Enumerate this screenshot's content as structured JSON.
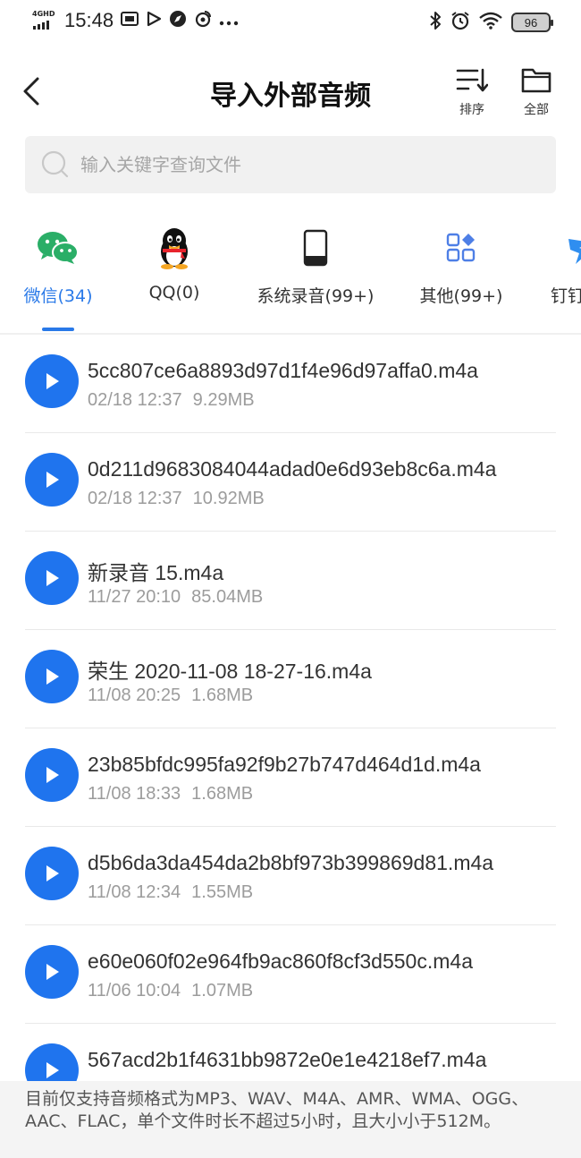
{
  "status_bar": {
    "network": "4GHD",
    "time": "15:48",
    "battery": "96"
  },
  "header": {
    "title": "导入外部音频",
    "sort_label": "排序",
    "all_label": "全部"
  },
  "search": {
    "placeholder": "输入关键字查询文件"
  },
  "tabs": [
    {
      "label": "微信(34)",
      "icon": "wechat-icon",
      "active": true
    },
    {
      "label": "QQ(0)",
      "icon": "qq-icon",
      "active": false
    },
    {
      "label": "系统录音(99+)",
      "icon": "phone-icon",
      "active": false
    },
    {
      "label": "其他(99+)",
      "icon": "apps-icon",
      "active": false
    },
    {
      "label": "钉钉",
      "icon": "dingtalk-icon",
      "active": false
    }
  ],
  "files": [
    {
      "name": "5cc807ce6a8893d97d1f4e96d97affa0.m4a",
      "date": "02/18 12:37",
      "size": "9.29MB"
    },
    {
      "name": "0d211d9683084044adad0e6d93eb8c6a.m4a",
      "date": "02/18 12:37",
      "size": "10.92MB"
    },
    {
      "name": "新录音 15.m4a",
      "date": "11/27 20:10",
      "size": "85.04MB"
    },
    {
      "name": "荣生 2020-11-08 18-27-16.m4a",
      "date": "11/08 20:25",
      "size": "1.68MB"
    },
    {
      "name": "23b85bfdc995fa92f9b27b747d464d1d.m4a",
      "date": "11/08 18:33",
      "size": "1.68MB"
    },
    {
      "name": "d5b6da3da454da2b8bf973b399869d81.m4a",
      "date": "11/08 12:34",
      "size": "1.55MB"
    },
    {
      "name": "e60e060f02e964fb9ac860f8cf3d550c.m4a",
      "date": "11/06 10:04",
      "size": "1.07MB"
    },
    {
      "name": "567acd2b1f4631bb9872e0e1e4218ef7.m4a",
      "date": "",
      "size": ""
    }
  ],
  "notice": "目前仅支持音频格式为MP3、WAV、M4A、AMR、WMA、OGG、AAC、FLAC，单个文件时长不超过5小时，且大小小于512M。",
  "colors": {
    "accent": "#2979e8",
    "play_button": "#1f74ee",
    "wechat": "#2aae67",
    "text_secondary": "#9c9c9c"
  }
}
